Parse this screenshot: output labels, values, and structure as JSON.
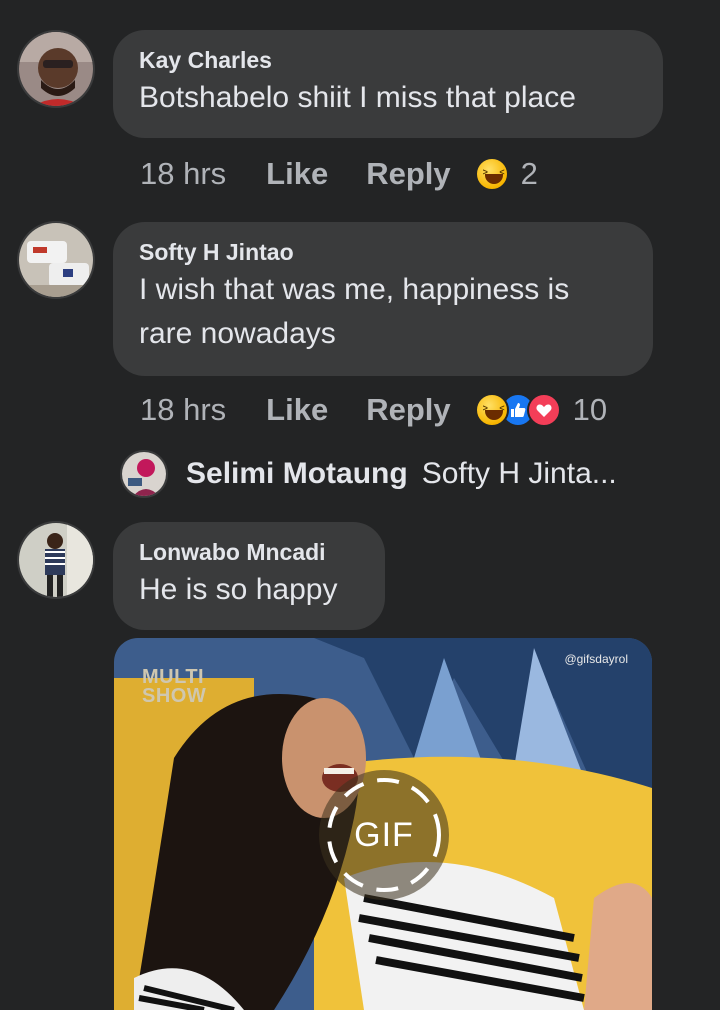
{
  "comments": [
    {
      "author": "Kay Charles",
      "text": "Botshabelo shiit I miss that place",
      "time": "18 hrs",
      "like_label": "Like",
      "reply_label": "Reply",
      "reactions": [
        "haha-icon"
      ],
      "reaction_count": "2"
    },
    {
      "author": "Softy H Jintao",
      "text_lines": [
        "I wish that was me, happiness is",
        "rare nowadays"
      ],
      "time": "18 hrs",
      "like_label": "Like",
      "reply_label": "Reply",
      "reactions": [
        "haha-icon",
        "like-icon",
        "love-icon"
      ],
      "reaction_count": "10"
    },
    {
      "author": "Lonwabo Mncadi",
      "text": "He is so happy",
      "gif": {
        "badge_label": "GIF",
        "watermark": "@gifsdayrol",
        "brand_line1": "MULTI",
        "brand_line2": "SHOW"
      }
    }
  ],
  "reply_preview": {
    "author": "Selimi Motaung",
    "snippet": "Softy H Jinta..."
  },
  "colors": {
    "background": "#232425",
    "bubble": "#3a3b3c",
    "text": "#e4e6eb",
    "muted": "#b0b3b8",
    "like_blue": "#1877f2",
    "love_red": "#f33e58"
  }
}
